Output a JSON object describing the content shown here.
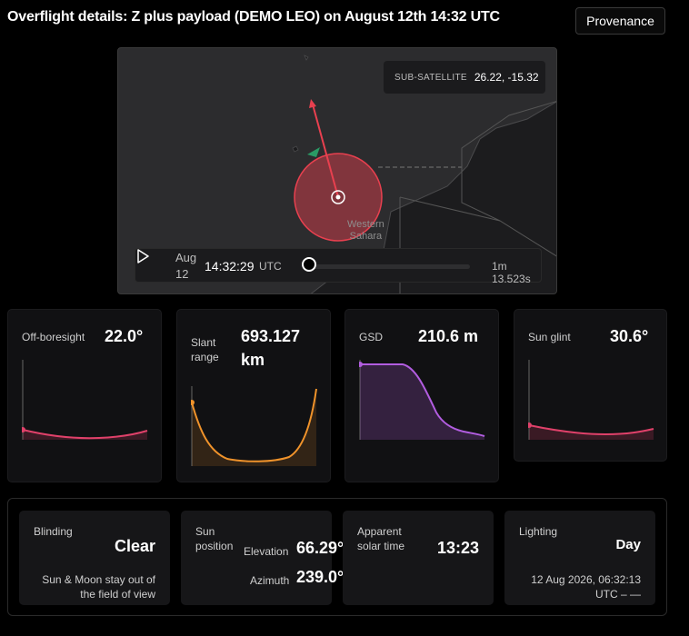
{
  "header": {
    "title": "Overflight details: Z plus payload (DEMO LEO) on August 12th 14:32 UTC",
    "provenance_label": "Provenance"
  },
  "map": {
    "subsat_label": "SUB-SATELLITE",
    "subsat_value": "26.22, -15.32",
    "place_line1": "Western",
    "place_line2": "Sahara",
    "footprint_color": "#e8404f",
    "target_color": "#2bb673"
  },
  "player": {
    "date": "Aug 12",
    "time": "14:32:29",
    "tz": "UTC",
    "duration": "1m 13.523s",
    "progress": 0.0
  },
  "metrics": [
    {
      "label": "Off-boresight",
      "value": "22.0°",
      "color": "#e0416a"
    },
    {
      "label": "Slant range",
      "value": "693.127 km",
      "color": "#f0932b"
    },
    {
      "label": "GSD",
      "value": "210.6 m",
      "color": "#b25de0"
    },
    {
      "label": "Sun glint",
      "value": "30.6°",
      "color": "#e0416a"
    }
  ],
  "bottom": {
    "blinding": {
      "label": "Blinding",
      "value": "Clear",
      "note_line1": "Sun & Moon stay out of",
      "note_line2": "the field of view"
    },
    "sun": {
      "label_line1": "Sun",
      "label_line2": "position",
      "elev_label": "Elevation",
      "elev_value": "66.29°",
      "az_label": "Azimuth",
      "az_value": "239.0°"
    },
    "solar": {
      "label_line1": "Apparent",
      "label_line2": "solar time",
      "value": "13:23"
    },
    "lighting": {
      "label": "Lighting",
      "value": "Day",
      "date_line1": "12 Aug 2026, 06:32:13",
      "date_line2": "UTC – —"
    }
  }
}
